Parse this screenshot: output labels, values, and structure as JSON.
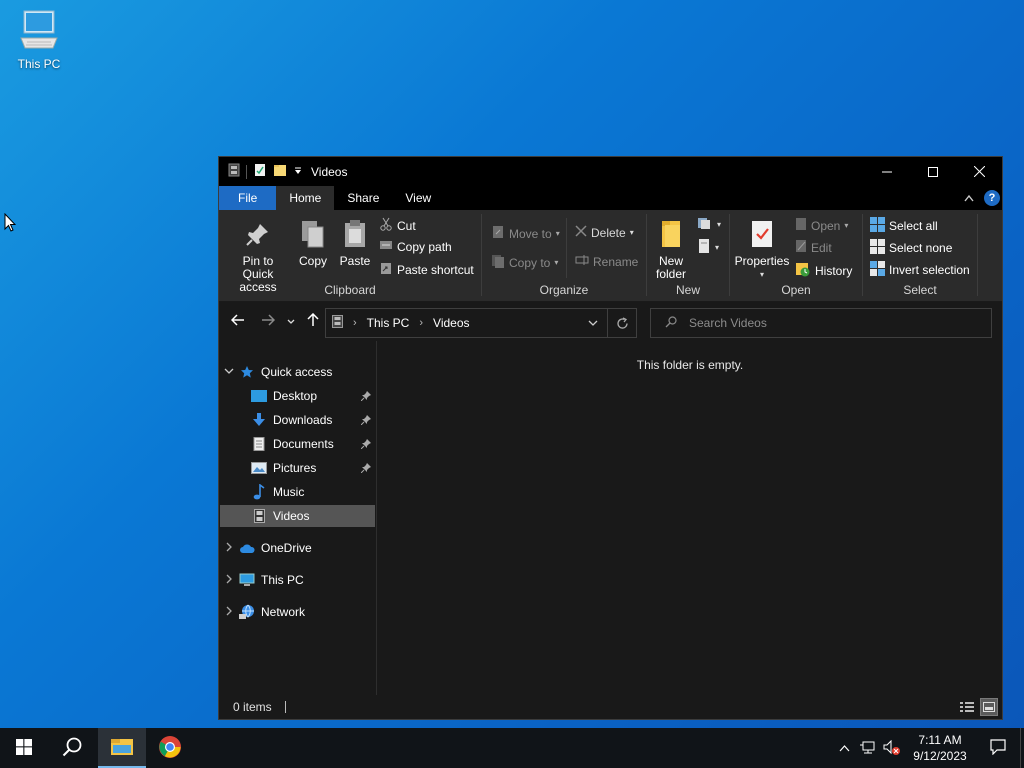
{
  "desktop": {
    "icon_label": "This PC"
  },
  "window": {
    "title": "Videos",
    "tabs": [
      "File",
      "Home",
      "Share",
      "View"
    ],
    "ribbon": {
      "clipboard": {
        "pin_label_1": "Pin to Quick",
        "pin_label_2": "access",
        "copy": "Copy",
        "paste": "Paste",
        "cut": "Cut",
        "copy_path": "Copy path",
        "paste_shortcut": "Paste shortcut",
        "group": "Clipboard"
      },
      "organize": {
        "move_to": "Move to",
        "copy_to": "Copy to",
        "delete": "Delete",
        "rename": "Rename",
        "group": "Organize"
      },
      "new": {
        "new_folder_1": "New",
        "new_folder_2": "folder",
        "group": "New"
      },
      "open": {
        "properties": "Properties",
        "open": "Open",
        "edit": "Edit",
        "history": "History",
        "group": "Open"
      },
      "select": {
        "select_all": "Select all",
        "select_none": "Select none",
        "invert": "Invert selection",
        "group": "Select"
      }
    },
    "address": {
      "crumbs": [
        "This PC",
        "Videos"
      ]
    },
    "search": {
      "placeholder": "Search Videos"
    },
    "nav": {
      "quick_access": "Quick access",
      "items": [
        "Desktop",
        "Downloads",
        "Documents",
        "Pictures",
        "Music",
        "Videos"
      ],
      "onedrive": "OneDrive",
      "this_pc": "This PC",
      "network": "Network"
    },
    "empty_message": "This folder is empty.",
    "status": {
      "items": "0 items"
    }
  },
  "taskbar": {
    "time": "7:11 AM",
    "date": "9/12/2023"
  },
  "colors": {
    "accent": "#1e6bc4",
    "selection": "#555555",
    "desktop": "#0a78d4"
  }
}
